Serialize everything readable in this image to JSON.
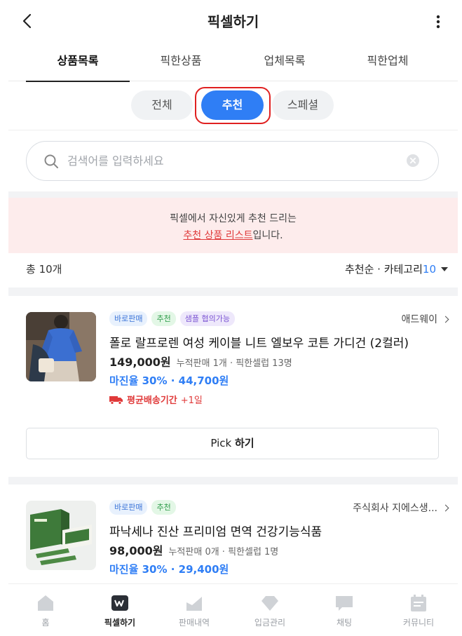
{
  "header": {
    "title": "픽셀하기"
  },
  "tabs": [
    {
      "label": "상품목록",
      "active": true
    },
    {
      "label": "픽한상품",
      "active": false
    },
    {
      "label": "업체목록",
      "active": false
    },
    {
      "label": "픽한업체",
      "active": false
    }
  ],
  "filters": [
    {
      "label": "전체",
      "active": false
    },
    {
      "label": "추천",
      "active": true
    },
    {
      "label": "스페셜",
      "active": false
    }
  ],
  "search": {
    "placeholder": "검색어를 입력하세요",
    "value": ""
  },
  "banner": {
    "line1": "픽셀에서 자신있게 추천 드리는",
    "highlight": "추천 상품 리스트",
    "suffix": "입니다."
  },
  "list": {
    "total_label": "총 10개",
    "sort_label": "추천순 · 카테고리",
    "category_count": "10"
  },
  "products": [
    {
      "badges": [
        "바로판매",
        "추천",
        "샘플 협의가능"
      ],
      "vendor": "애드웨이",
      "name": "폴로 랄프로렌 여성 케이블 니트 엘보우 코튼 가디건 (2컬러)",
      "price": "149,000원",
      "meta": "누적판매 1개 · 픽한셀럽 13명",
      "margin": "마진율 30% · 44,700원",
      "ship_label": "평균배송기간",
      "ship_value": "+1일",
      "pick_prefix": "Pick",
      "pick_bold": "하기"
    },
    {
      "badges": [
        "바로판매",
        "추천"
      ],
      "vendor": "주식회사 지에스생...",
      "name": "파낙세나 진산 프리미엄 면역 건강기능식품",
      "price": "98,000원",
      "meta": "누적판매 0개 · 픽한셀럽 1명",
      "margin": "마진율 30% · 29,400원"
    }
  ],
  "bottom_nav": [
    {
      "label": "홈",
      "icon": "home-icon",
      "active": false
    },
    {
      "label": "픽셀하기",
      "icon": "pixel-logo-icon",
      "active": true
    },
    {
      "label": "판매내역",
      "icon": "chart-icon",
      "active": false
    },
    {
      "label": "입금관리",
      "icon": "diamond-icon",
      "active": false
    },
    {
      "label": "채팅",
      "icon": "chat-icon",
      "active": false
    },
    {
      "label": "커뮤니티",
      "icon": "calendar-icon",
      "active": false
    }
  ],
  "colors": {
    "accent": "#2f7ef5",
    "highlight_border": "#e02020",
    "banner_bg": "#fdecec",
    "warn": "#e03a3a"
  }
}
